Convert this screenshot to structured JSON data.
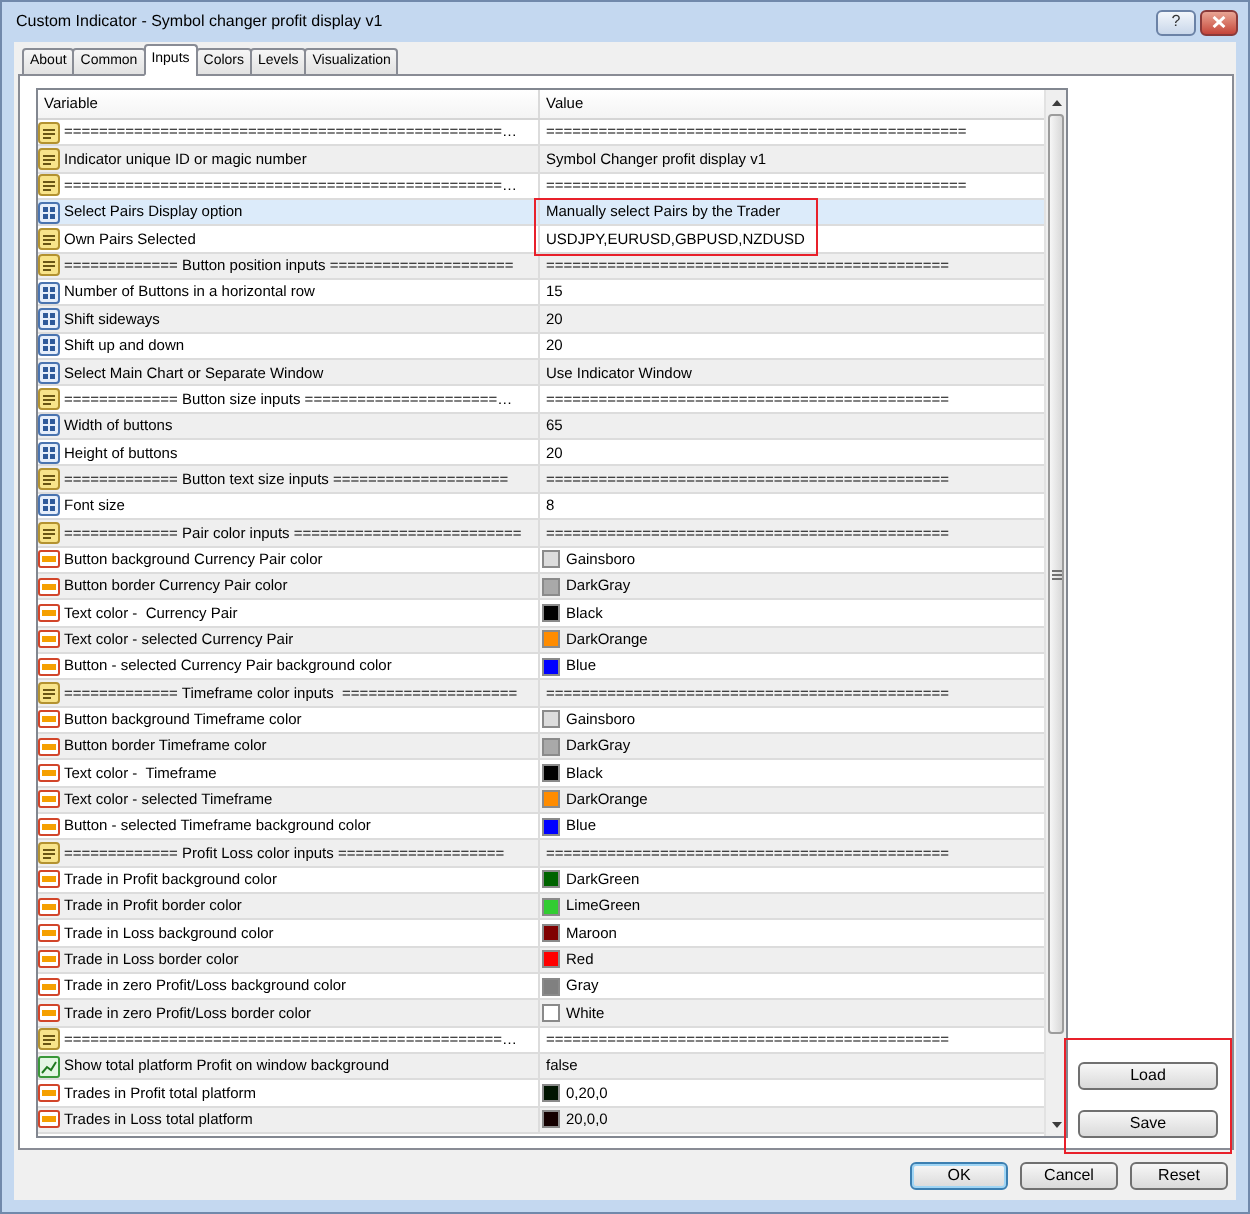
{
  "window": {
    "title": "Custom Indicator - Symbol changer profit display v1",
    "help": "?"
  },
  "tabs": [
    {
      "label": "About",
      "selected": false
    },
    {
      "label": "Common",
      "selected": false
    },
    {
      "label": "Inputs",
      "selected": true
    },
    {
      "label": "Colors",
      "selected": false
    },
    {
      "label": "Levels",
      "selected": false
    },
    {
      "label": "Visualization",
      "selected": false
    }
  ],
  "table": {
    "columns": [
      "Variable",
      "Value"
    ],
    "rows": [
      {
        "kind": "string",
        "variable": "==================================================…",
        "value": "================================================",
        "selected": false,
        "boxed": false
      },
      {
        "kind": "string",
        "variable": "Indicator unique ID or magic number",
        "value": "Symbol Changer profit display v1",
        "selected": false,
        "boxed": false
      },
      {
        "kind": "string",
        "variable": "==================================================…",
        "value": "================================================",
        "selected": false,
        "boxed": false
      },
      {
        "kind": "number",
        "variable": "Select Pairs Display option",
        "value": "Manually select Pairs by the Trader",
        "selected": true,
        "boxed": true
      },
      {
        "kind": "string",
        "variable": "Own Pairs Selected",
        "value": "USDJPY,EURUSD,GBPUSD,NZDUSD",
        "selected": false,
        "boxed": true
      },
      {
        "kind": "string",
        "variable": "============= Button position inputs =====================",
        "value": "==============================================",
        "selected": false,
        "boxed": false
      },
      {
        "kind": "number",
        "variable": "Number of Buttons in a horizontal row",
        "value": "15",
        "selected": false,
        "boxed": false
      },
      {
        "kind": "number",
        "variable": "Shift sideways",
        "value": "20",
        "selected": false,
        "boxed": false
      },
      {
        "kind": "number",
        "variable": "Shift up and down",
        "value": "20",
        "selected": false,
        "boxed": false
      },
      {
        "kind": "number",
        "variable": "Select Main Chart or Separate Window",
        "value": "Use Indicator Window",
        "selected": false,
        "boxed": false
      },
      {
        "kind": "string",
        "variable": "============= Button size inputs ======================…",
        "value": "==============================================",
        "selected": false,
        "boxed": false
      },
      {
        "kind": "number",
        "variable": "Width of buttons",
        "value": "65",
        "selected": false,
        "boxed": false
      },
      {
        "kind": "number",
        "variable": "Height of buttons",
        "value": "20",
        "selected": false,
        "boxed": false
      },
      {
        "kind": "string",
        "variable": "============= Button text size inputs ====================",
        "value": "==============================================",
        "selected": false,
        "boxed": false
      },
      {
        "kind": "number",
        "variable": "Font size",
        "value": "8",
        "selected": false,
        "boxed": false
      },
      {
        "kind": "string",
        "variable": "============= Pair color inputs ==========================",
        "value": "==============================================",
        "selected": false,
        "boxed": false
      },
      {
        "kind": "color",
        "variable": "Button background Currency Pair color",
        "value": "Gainsboro",
        "color": "#dcdcdc",
        "selected": false,
        "boxed": false
      },
      {
        "kind": "color",
        "variable": "Button border Currency Pair color",
        "value": "DarkGray",
        "color": "#a9a9a9",
        "selected": false,
        "boxed": false
      },
      {
        "kind": "color",
        "variable": "Text color -  Currency Pair",
        "value": "Black",
        "color": "#000000",
        "selected": false,
        "boxed": false
      },
      {
        "kind": "color",
        "variable": "Text color - selected Currency Pair",
        "value": "DarkOrange",
        "color": "#ff8c00",
        "selected": false,
        "boxed": false
      },
      {
        "kind": "color",
        "variable": "Button - selected Currency Pair background color",
        "value": "Blue",
        "color": "#0000ff",
        "selected": false,
        "boxed": false
      },
      {
        "kind": "string",
        "variable": "============= Timeframe color inputs  ====================",
        "value": "==============================================",
        "selected": false,
        "boxed": false
      },
      {
        "kind": "color",
        "variable": "Button background Timeframe color",
        "value": "Gainsboro",
        "color": "#dcdcdc",
        "selected": false,
        "boxed": false
      },
      {
        "kind": "color",
        "variable": "Button border Timeframe color",
        "value": "DarkGray",
        "color": "#a9a9a9",
        "selected": false,
        "boxed": false
      },
      {
        "kind": "color",
        "variable": "Text color -  Timeframe",
        "value": "Black",
        "color": "#000000",
        "selected": false,
        "boxed": false
      },
      {
        "kind": "color",
        "variable": "Text color - selected Timeframe",
        "value": "DarkOrange",
        "color": "#ff8c00",
        "selected": false,
        "boxed": false
      },
      {
        "kind": "color",
        "variable": "Button - selected Timeframe background color",
        "value": "Blue",
        "color": "#0000ff",
        "selected": false,
        "boxed": false
      },
      {
        "kind": "string",
        "variable": "============= Profit Loss color inputs ===================",
        "value": "==============================================",
        "selected": false,
        "boxed": false
      },
      {
        "kind": "color",
        "variable": "Trade in Profit background color",
        "value": "DarkGreen",
        "color": "#006400",
        "selected": false,
        "boxed": false
      },
      {
        "kind": "color",
        "variable": "Trade in Profit border color",
        "value": "LimeGreen",
        "color": "#32cd32",
        "selected": false,
        "boxed": false
      },
      {
        "kind": "color",
        "variable": "Trade in Loss background color",
        "value": "Maroon",
        "color": "#800000",
        "selected": false,
        "boxed": false
      },
      {
        "kind": "color",
        "variable": "Trade in Loss border color",
        "value": "Red",
        "color": "#ff0000",
        "selected": false,
        "boxed": false
      },
      {
        "kind": "color",
        "variable": "Trade in zero Profit/Loss background color",
        "value": "Gray",
        "color": "#808080",
        "selected": false,
        "boxed": false
      },
      {
        "kind": "color",
        "variable": "Trade in zero Profit/Loss border color",
        "value": "White",
        "color": "#ffffff",
        "selected": false,
        "boxed": false
      },
      {
        "kind": "string",
        "variable": "==================================================…",
        "value": "==============================================",
        "selected": false,
        "boxed": false
      },
      {
        "kind": "bool",
        "variable": "Show total platform Profit on window background",
        "value": "false",
        "selected": false,
        "boxed": false
      },
      {
        "kind": "color",
        "variable": "Trades in Profit total platform",
        "value": "0,20,0",
        "color": "#001400",
        "selected": false,
        "boxed": false
      },
      {
        "kind": "color",
        "variable": "Trades in Loss total platform",
        "value": "20,0,0",
        "color": "#140000",
        "selected": false,
        "boxed": false
      }
    ]
  },
  "side_panel": {
    "boxed": true,
    "buttons": [
      "Load",
      "Save"
    ]
  },
  "buttons": [
    {
      "label": "OK",
      "default": true
    },
    {
      "label": "Cancel",
      "default": false
    },
    {
      "label": "Reset",
      "default": false
    }
  ]
}
